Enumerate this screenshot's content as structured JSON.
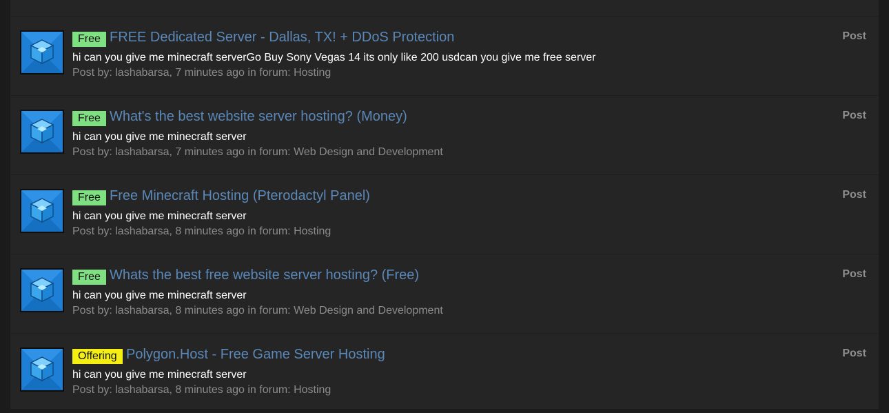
{
  "rows": [
    {
      "badge": "Free",
      "badge_type": "free",
      "title": "FREE Dedicated Server - Dallas, TX! + DDoS Protection",
      "body": "hi can you give me minecraft serverGo Buy Sony Vegas 14 its only like 200 usdcan you give me free server",
      "meta_prefix": "Post by: ",
      "author": "lashabarsa",
      "time": ", 7 minutes ago in forum: ",
      "forum": "Hosting",
      "kind": "Post"
    },
    {
      "badge": "Free",
      "badge_type": "free",
      "title": "What's the best website server hosting? (Money)",
      "body": "hi can you give me minecraft server",
      "meta_prefix": "Post by: ",
      "author": "lashabarsa",
      "time": ", 7 minutes ago in forum: ",
      "forum": "Web Design and Development",
      "kind": "Post"
    },
    {
      "badge": "Free",
      "badge_type": "free",
      "title": "Free Minecraft Hosting (Pterodactyl Panel)",
      "body": "hi can you give me minecraft server",
      "meta_prefix": "Post by: ",
      "author": "lashabarsa",
      "time": ", 8 minutes ago in forum: ",
      "forum": "Hosting",
      "kind": "Post"
    },
    {
      "badge": "Free",
      "badge_type": "free",
      "title": "Whats the best free website server hosting? (Free)",
      "body": "hi can you give me minecraft server",
      "meta_prefix": "Post by: ",
      "author": "lashabarsa",
      "time": ", 8 minutes ago in forum: ",
      "forum": "Web Design and Development",
      "kind": "Post"
    },
    {
      "badge": "Offering",
      "badge_type": "offering",
      "title": "Polygon.Host - Free Game Server Hosting",
      "body": "hi can you give me minecraft server",
      "meta_prefix": "Post by: ",
      "author": "lashabarsa",
      "time": ", 8 minutes ago in forum: ",
      "forum": "Hosting",
      "kind": "Post"
    }
  ],
  "colors": {
    "free_badge": "#7ee081",
    "offering_badge": "#f4ee12",
    "title_link": "#5a88b8",
    "background": "#252525"
  },
  "icons": {
    "avatar": "blue-cube-avatar-icon"
  }
}
